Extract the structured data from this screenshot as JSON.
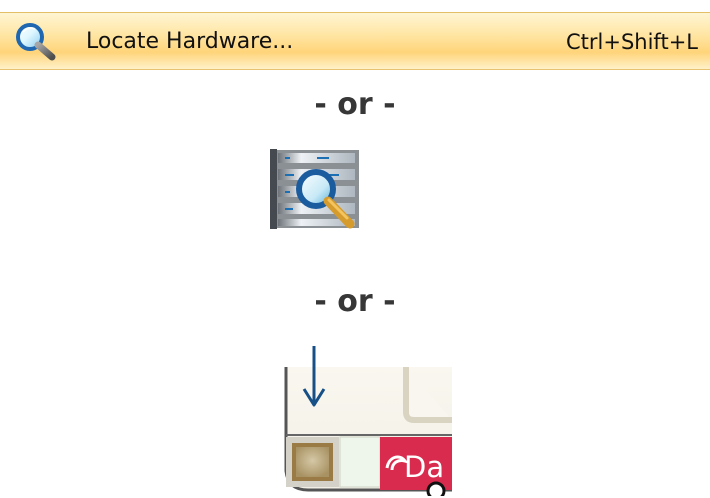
{
  "menu": {
    "item": {
      "icon": "magnifier-icon",
      "label": "Locate Hardware...",
      "shortcut": "Ctrl+Shift+L"
    }
  },
  "separators": {
    "first": "- or -",
    "second": "- or -"
  },
  "toolbar": {
    "icon": "locate-hardware-toolbar-icon"
  },
  "instrument_preview": {
    "arrow_icon": "down-arrow-icon",
    "brand_text": "Da",
    "accent_color": "#d82b4d"
  },
  "colors": {
    "menu_highlight": "#ffd47a",
    "menu_border": "#e3bf68",
    "text": "#111111",
    "separator_text": "#373737"
  }
}
